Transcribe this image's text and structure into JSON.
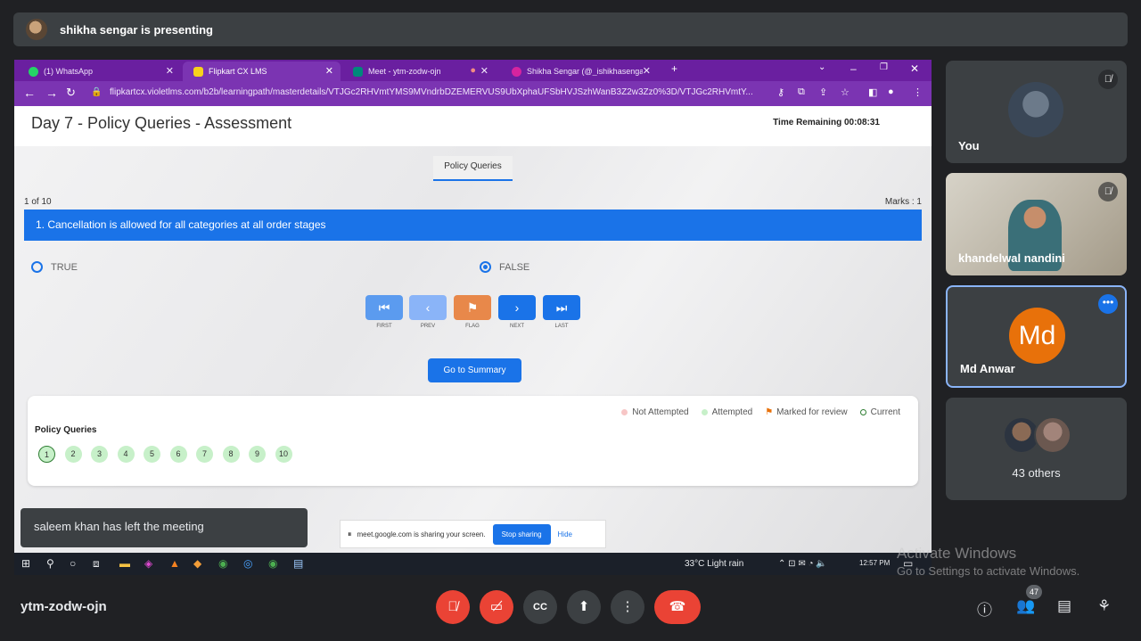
{
  "presenter": {
    "text": "shikha sengar is presenting"
  },
  "browser": {
    "tabs": [
      {
        "label": "(1) WhatsApp"
      },
      {
        "label": "Flipkart CX LMS"
      },
      {
        "label": "Meet - ytm-zodw-ojn"
      },
      {
        "label": "Shikha Sengar (@_ishikhasengar"
      }
    ],
    "url": "flipkartcx.violetlms.com/b2b/learningpath/masterdetails/VTJGc2RHVmtYMS9MVndrbDZEMERVUS9UbXphaUFSbHVJSzhWanB3Z2w3Zz0%3D/VTJGc2RHVmtY..."
  },
  "assessment": {
    "title": "Day 7 - Policy Queries - Assessment",
    "time_remaining": "Time Remaining 00:08:31",
    "section_tab": "Policy Queries",
    "question_count": "1 of 10",
    "marks": "Marks : 1",
    "question": "1. Cancellation is allowed for all categories at all order stages",
    "options": [
      {
        "label": "TRUE",
        "selected": false
      },
      {
        "label": "FALSE",
        "selected": true
      }
    ],
    "nav": {
      "first": "FIRST",
      "prev": "PREV",
      "flag": "FLAG",
      "next": "NEXT",
      "last": "LAST"
    },
    "summary_button": "Go to Summary",
    "legend": {
      "not_attempted": "Not Attempted",
      "attempted": "Attempted",
      "marked": "Marked for review",
      "current": "Current"
    },
    "palette_title": "Policy Queries",
    "question_numbers": [
      "1",
      "2",
      "3",
      "4",
      "5",
      "6",
      "7",
      "8",
      "9",
      "10"
    ]
  },
  "notifications": {
    "left_meeting": "saleem khan has left the meeting",
    "sharing_text": "meet.google.com is sharing your screen.",
    "stop_sharing": "Stop sharing",
    "hide": "Hide"
  },
  "taskbar": {
    "weather": "33°C  Light rain",
    "clock": "12:57 PM"
  },
  "watermark": {
    "line1": "Activate Windows",
    "line2": "Go to Settings to activate Windows."
  },
  "participants": {
    "you": "You",
    "p2": "khandelwal nandini",
    "p3": "Md Anwar",
    "p3_initials": "Md",
    "others": "43 others"
  },
  "meeting": {
    "code": "ytm-zodw-ojn",
    "people_count": "47"
  },
  "colors": {
    "accent": "#1a73e8",
    "browser_theme": "#7b34b2",
    "end_call": "#ea4335",
    "avatar": "#e8710a"
  }
}
